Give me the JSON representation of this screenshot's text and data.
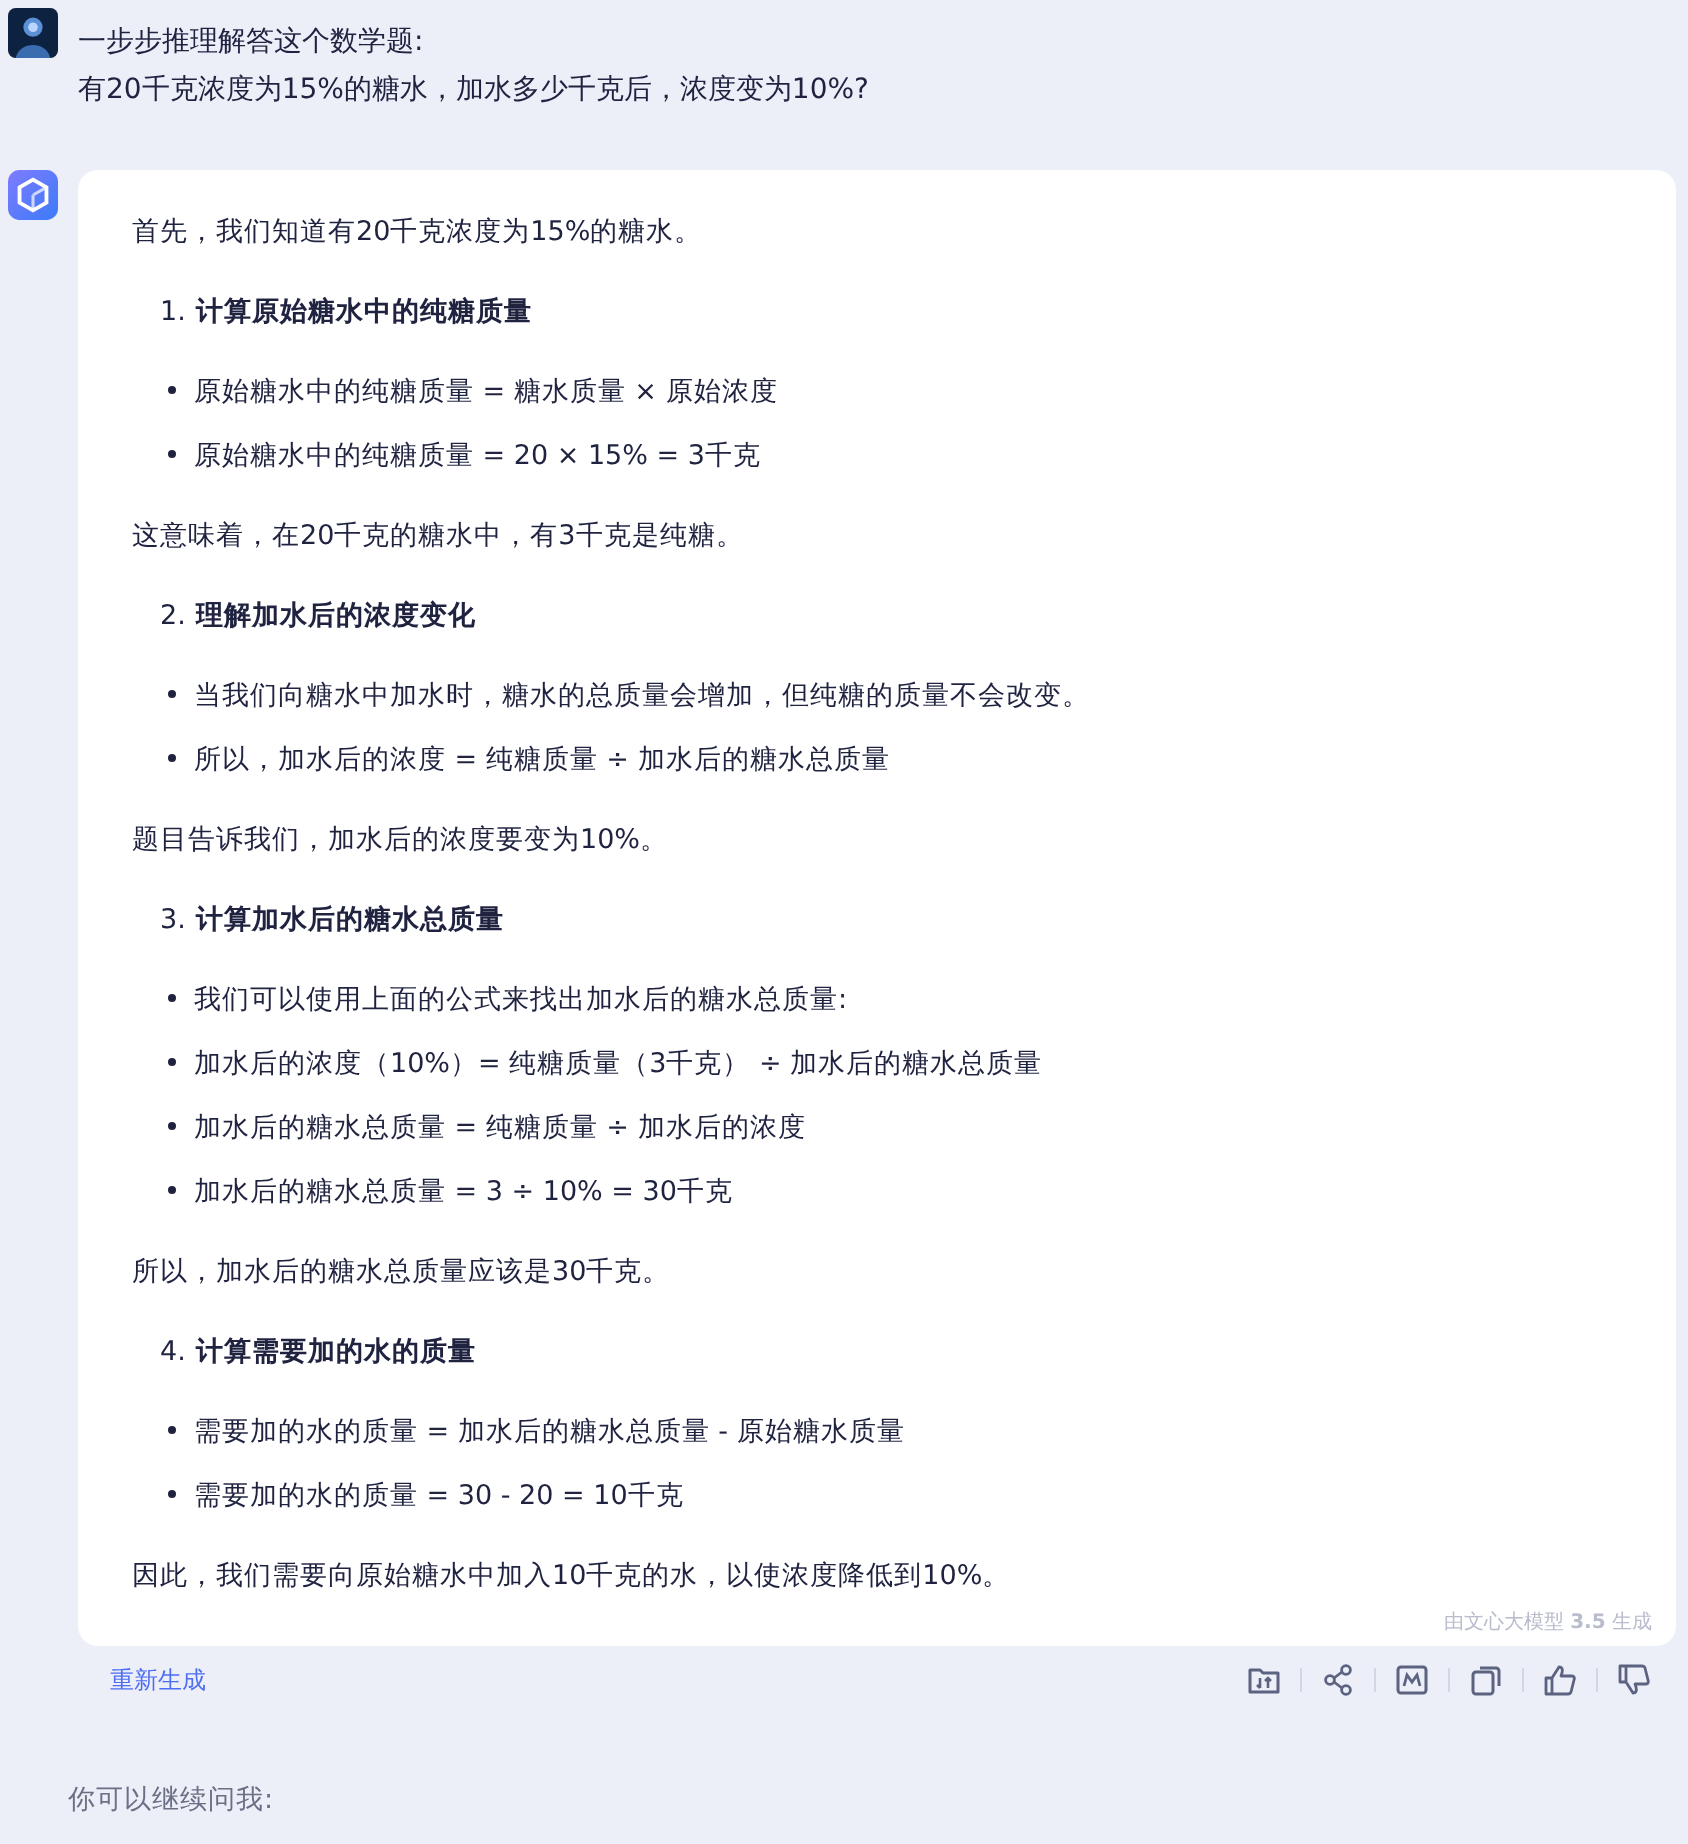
{
  "question": {
    "lines": [
      "一步步推理解答这个数学题:",
      "有20千克浓度为15%的糖水，加水多少千克后，浓度变为10%?"
    ]
  },
  "answer": {
    "blocks": [
      {
        "kind": "paragraph",
        "text": "首先，我们知道有20千克浓度为15%的糖水。"
      },
      {
        "kind": "heading",
        "number": "1.",
        "text": "计算原始糖水中的纯糖质量"
      },
      {
        "kind": "bullet",
        "text": "原始糖水中的纯糖质量 = 糖水质量 × 原始浓度"
      },
      {
        "kind": "bullet",
        "text": "原始糖水中的纯糖质量 = 20 × 15% = 3千克"
      },
      {
        "kind": "paragraph",
        "text": "这意味着，在20千克的糖水中，有3千克是纯糖。"
      },
      {
        "kind": "heading",
        "number": "2.",
        "text": "理解加水后的浓度变化"
      },
      {
        "kind": "bullet",
        "text": "当我们向糖水中加水时，糖水的总质量会增加，但纯糖的质量不会改变。"
      },
      {
        "kind": "bullet",
        "text": "所以，加水后的浓度 = 纯糖质量 ÷ 加水后的糖水总质量"
      },
      {
        "kind": "paragraph",
        "text": "题目告诉我们，加水后的浓度要变为10%。"
      },
      {
        "kind": "heading",
        "number": "3.",
        "text": "计算加水后的糖水总质量"
      },
      {
        "kind": "bullet",
        "text": "我们可以使用上面的公式来找出加水后的糖水总质量:"
      },
      {
        "kind": "bullet",
        "text": "加水后的浓度（10%）= 纯糖质量（3千克） ÷ 加水后的糖水总质量"
      },
      {
        "kind": "bullet",
        "text": "加水后的糖水总质量 = 纯糖质量 ÷ 加水后的浓度"
      },
      {
        "kind": "bullet",
        "text": "加水后的糖水总质量 = 3 ÷ 10% = 30千克"
      },
      {
        "kind": "paragraph",
        "text": "所以，加水后的糖水总质量应该是30千克。"
      },
      {
        "kind": "heading",
        "number": "4.",
        "text": "计算需要加的水的质量"
      },
      {
        "kind": "bullet",
        "text": "需要加的水的质量 = 加水后的糖水总质量 - 原始糖水质量"
      },
      {
        "kind": "bullet",
        "text": "需要加的水的质量 = 30 - 20 = 10千克"
      },
      {
        "kind": "paragraph",
        "text": "因此，我们需要向原始糖水中加入10千克的水，以使浓度降低到10%。"
      }
    ],
    "footnote": "由文心大模型 **3.5** 生成"
  },
  "regenerate": "重新生成",
  "follow_up": "你可以继续问我:"
}
